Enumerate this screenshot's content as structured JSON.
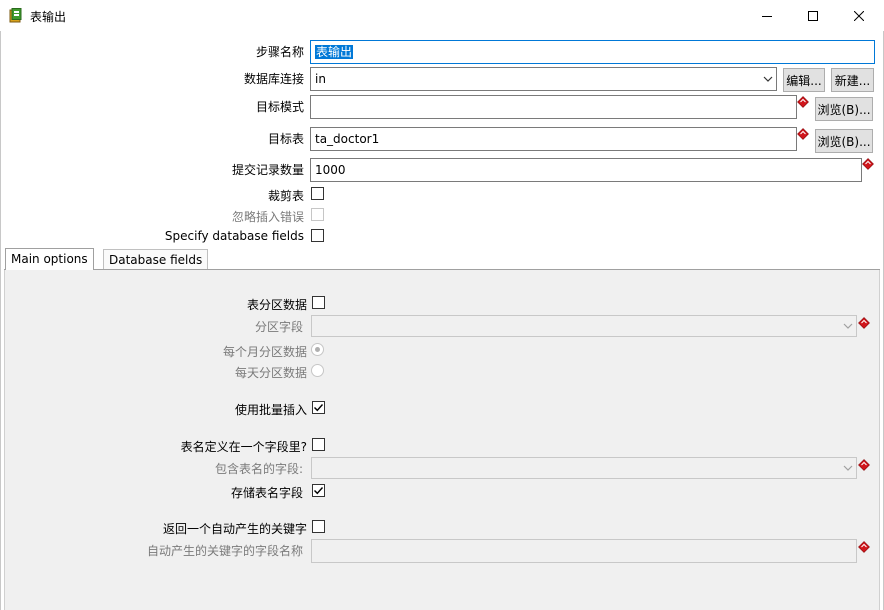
{
  "window": {
    "title": "表输出",
    "icons": {
      "app": "table-output-icon",
      "minimize": "minimize-icon",
      "maximize": "maximize-icon",
      "close": "close-icon"
    }
  },
  "form": {
    "step_name_label": "步骤名称",
    "step_name_value": "表输出",
    "db_conn_label": "数据库连接",
    "db_conn_value": "in",
    "edit_button": "编辑...",
    "new_button": "新建...",
    "target_schema_label": "目标模式",
    "target_schema_value": "",
    "browse_button_1": "浏览(B)...",
    "target_table_label": "目标表",
    "target_table_value": "ta_doctor1",
    "browse_button_2": "浏览(B)...",
    "commit_size_label": "提交记录数量",
    "commit_size_value": "1000",
    "truncate_label": "裁剪表",
    "truncate_checked": false,
    "ignore_errors_label": "忽略插入错误",
    "ignore_errors_checked": false,
    "specify_fields_label": "Specify database fields",
    "specify_fields_checked": false
  },
  "tabs": [
    {
      "label": "Main options",
      "active": true
    },
    {
      "label": "Database fields",
      "active": false
    }
  ],
  "main_options": {
    "partition_label": "表分区数据",
    "partition_checked": false,
    "partition_field_label": "分区字段",
    "partition_field_value": "",
    "monthly_label": "每个月分区数据",
    "monthly_selected": true,
    "daily_label": "每天分区数据",
    "daily_selected": false,
    "batch_insert_label": "使用批量插入",
    "batch_insert_checked": true,
    "table_in_field_label": "表名定义在一个字段里?",
    "table_in_field_checked": false,
    "table_name_field_label": "包含表名的字段:",
    "table_name_field_value": "",
    "store_table_name_label": "存储表名字段",
    "store_table_name_checked": true,
    "return_key_label": "返回一个自动产生的关键字",
    "return_key_checked": false,
    "key_field_name_label": "自动产生的关键字的字段名称",
    "key_field_name_value": ""
  },
  "colors": {
    "selection": "#0078d7",
    "panel_bg": "#f0f0f0",
    "variable_diamond": "#d0161c"
  }
}
